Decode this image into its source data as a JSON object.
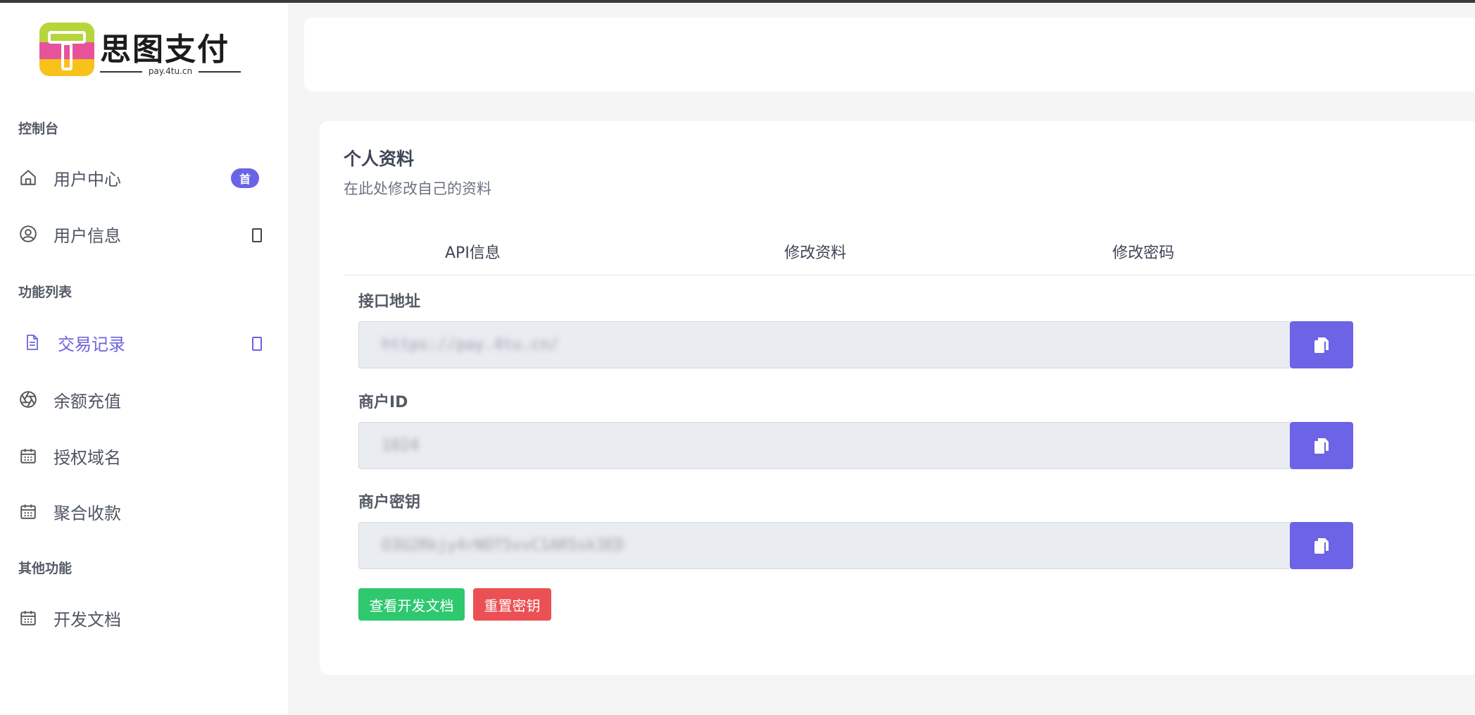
{
  "brand": {
    "logo_text": "思图支付",
    "logo_sub": "pay.4tu.cn"
  },
  "sidebar": {
    "sections": [
      {
        "title": "控制台"
      },
      {
        "title": "功能列表"
      },
      {
        "title": "其他功能"
      }
    ],
    "items": [
      {
        "label": "用户中心",
        "icon": "home-icon",
        "badge": "首"
      },
      {
        "label": "用户信息",
        "icon": "user-circle-icon"
      },
      {
        "label": "交易记录",
        "icon": "document-icon",
        "active": true
      },
      {
        "label": "余额充值",
        "icon": "aperture-icon"
      },
      {
        "label": "授权域名",
        "icon": "calendar-icon"
      },
      {
        "label": "聚合收款",
        "icon": "calendar-icon"
      },
      {
        "label": "开发文档",
        "icon": "calendar-icon"
      }
    ]
  },
  "main": {
    "title": "个人资料",
    "subtitle": "在此处修改自己的资料",
    "tabs": [
      {
        "label": "API信息"
      },
      {
        "label": "修改资料"
      },
      {
        "label": "修改密码"
      }
    ],
    "fields": [
      {
        "label": "接口地址",
        "value": "https://pay.4tu.cn/"
      },
      {
        "label": "商户ID",
        "value": "1024"
      },
      {
        "label": "商户密钥",
        "value": "O3U2Rkjy4rNOT5vvC1AR5sk3ED"
      }
    ],
    "buttons": {
      "docs": "查看开发文档",
      "reset_key": "重置密钥"
    }
  },
  "colors": {
    "accent": "#6c63e6",
    "green": "#2ec86f",
    "red": "#eb5055"
  }
}
